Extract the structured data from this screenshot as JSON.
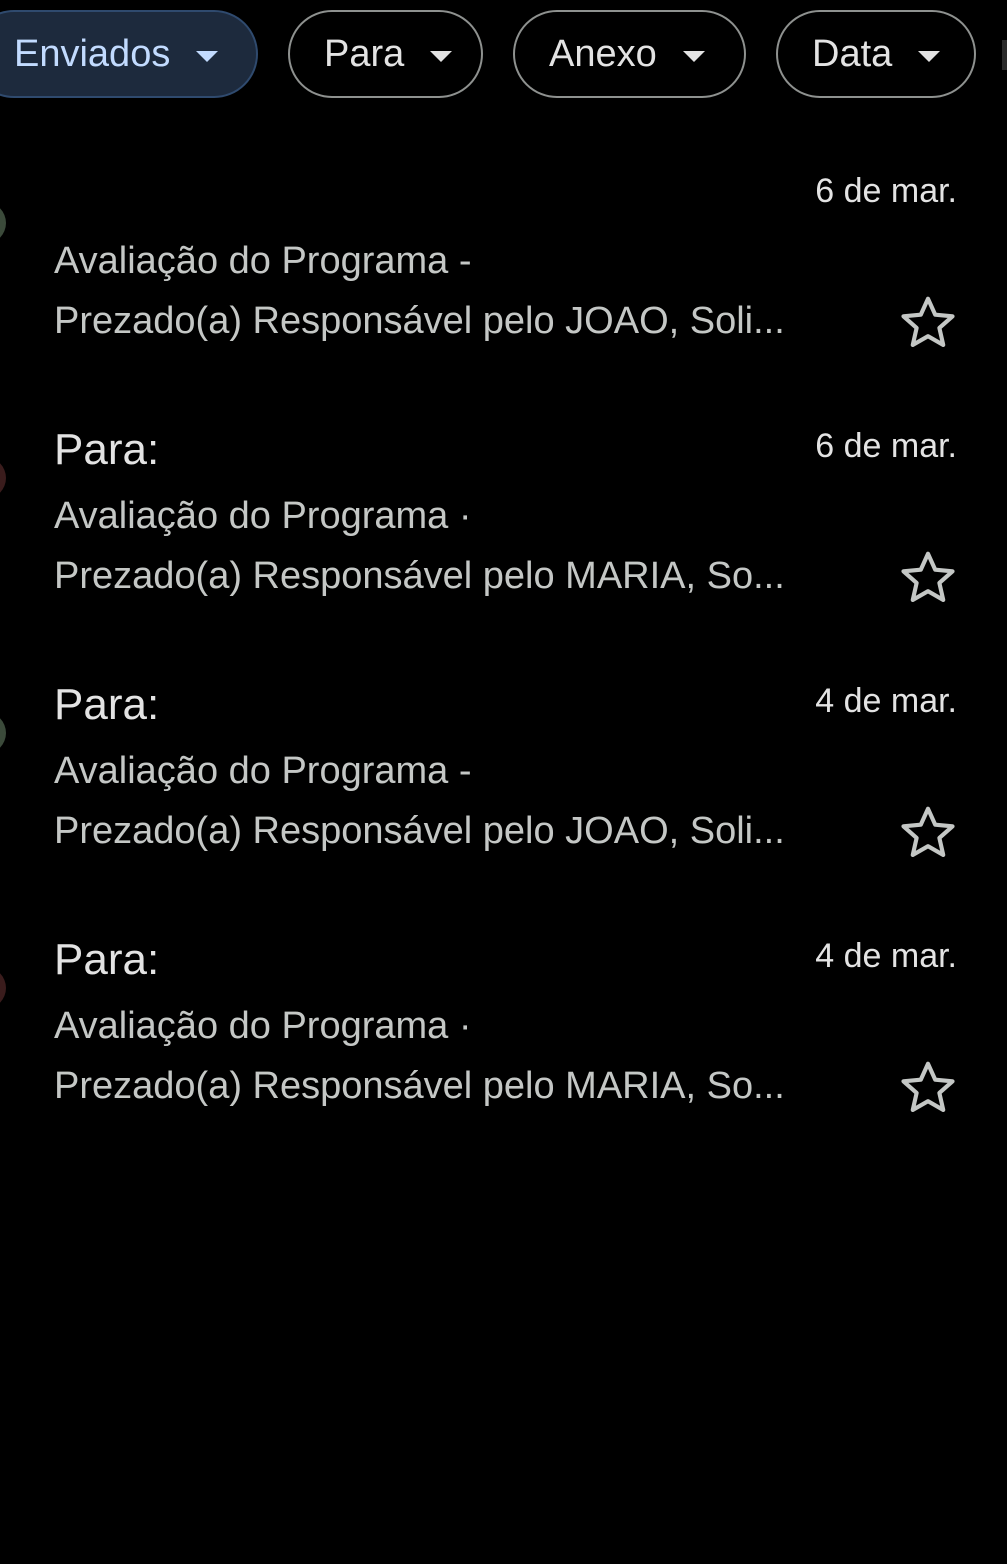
{
  "filters": {
    "chips": [
      {
        "label": "Enviados",
        "active": true
      },
      {
        "label": "Para",
        "active": false
      },
      {
        "label": "Anexo",
        "active": false
      },
      {
        "label": "Data",
        "active": false
      }
    ]
  },
  "emails": [
    {
      "sender": "",
      "date": "6 de mar.",
      "subject": "Avaliação do Programa - ",
      "snippet": "Prezado(a) Responsável pelo JOAO, Soli...",
      "starred": false
    },
    {
      "sender": "Para: ",
      "date": "6 de mar.",
      "subject": "Avaliação do Programa ·",
      "snippet": "Prezado(a) Responsável pelo MARIA, So...",
      "starred": false
    },
    {
      "sender": "Para: ",
      "date": "4 de mar.",
      "subject": "Avaliação do Programa - ",
      "snippet": "Prezado(a) Responsável pelo JOAO, Soli...",
      "starred": false
    },
    {
      "sender": "Para: ",
      "date": "4 de mar.",
      "subject": "Avaliação do Programa ·",
      "snippet": "Prezado(a) Responsável pelo MARIA, So...",
      "starred": false
    }
  ],
  "colors": {
    "background": "#000000",
    "active_chip_bg": "#1d2a3d",
    "active_chip_text": "#c2dbff",
    "text_primary": "#e3e3e3",
    "text_secondary": "#c4c7c5"
  }
}
